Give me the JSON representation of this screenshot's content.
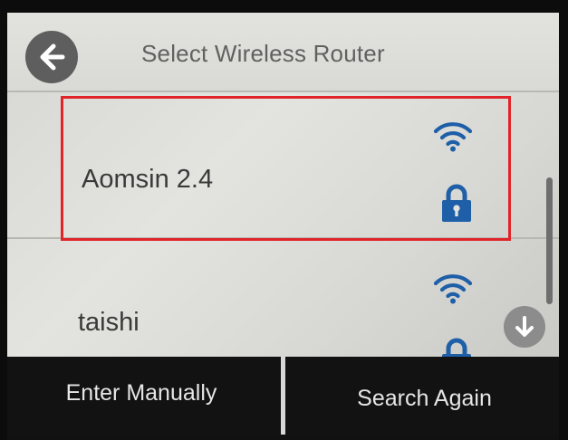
{
  "header": {
    "title": "Select Wireless Router",
    "back_icon": "back-arrow-icon"
  },
  "networks": [
    {
      "ssid": "Aomsin 2.4",
      "signal_icon": "wifi-icon",
      "security_icon": "lock-icon",
      "selected": true
    },
    {
      "ssid": "taishi",
      "signal_icon": "wifi-icon",
      "security_icon": "lock-icon",
      "selected": false
    }
  ],
  "scroll": {
    "down_icon": "arrow-down-icon"
  },
  "footer": {
    "enter_manually_label": "Enter Manually",
    "search_again_label": "Search Again"
  },
  "colors": {
    "accent_blue": "#1f5fa8",
    "highlight_red": "#e0242a",
    "button_bar": "#121212"
  }
}
